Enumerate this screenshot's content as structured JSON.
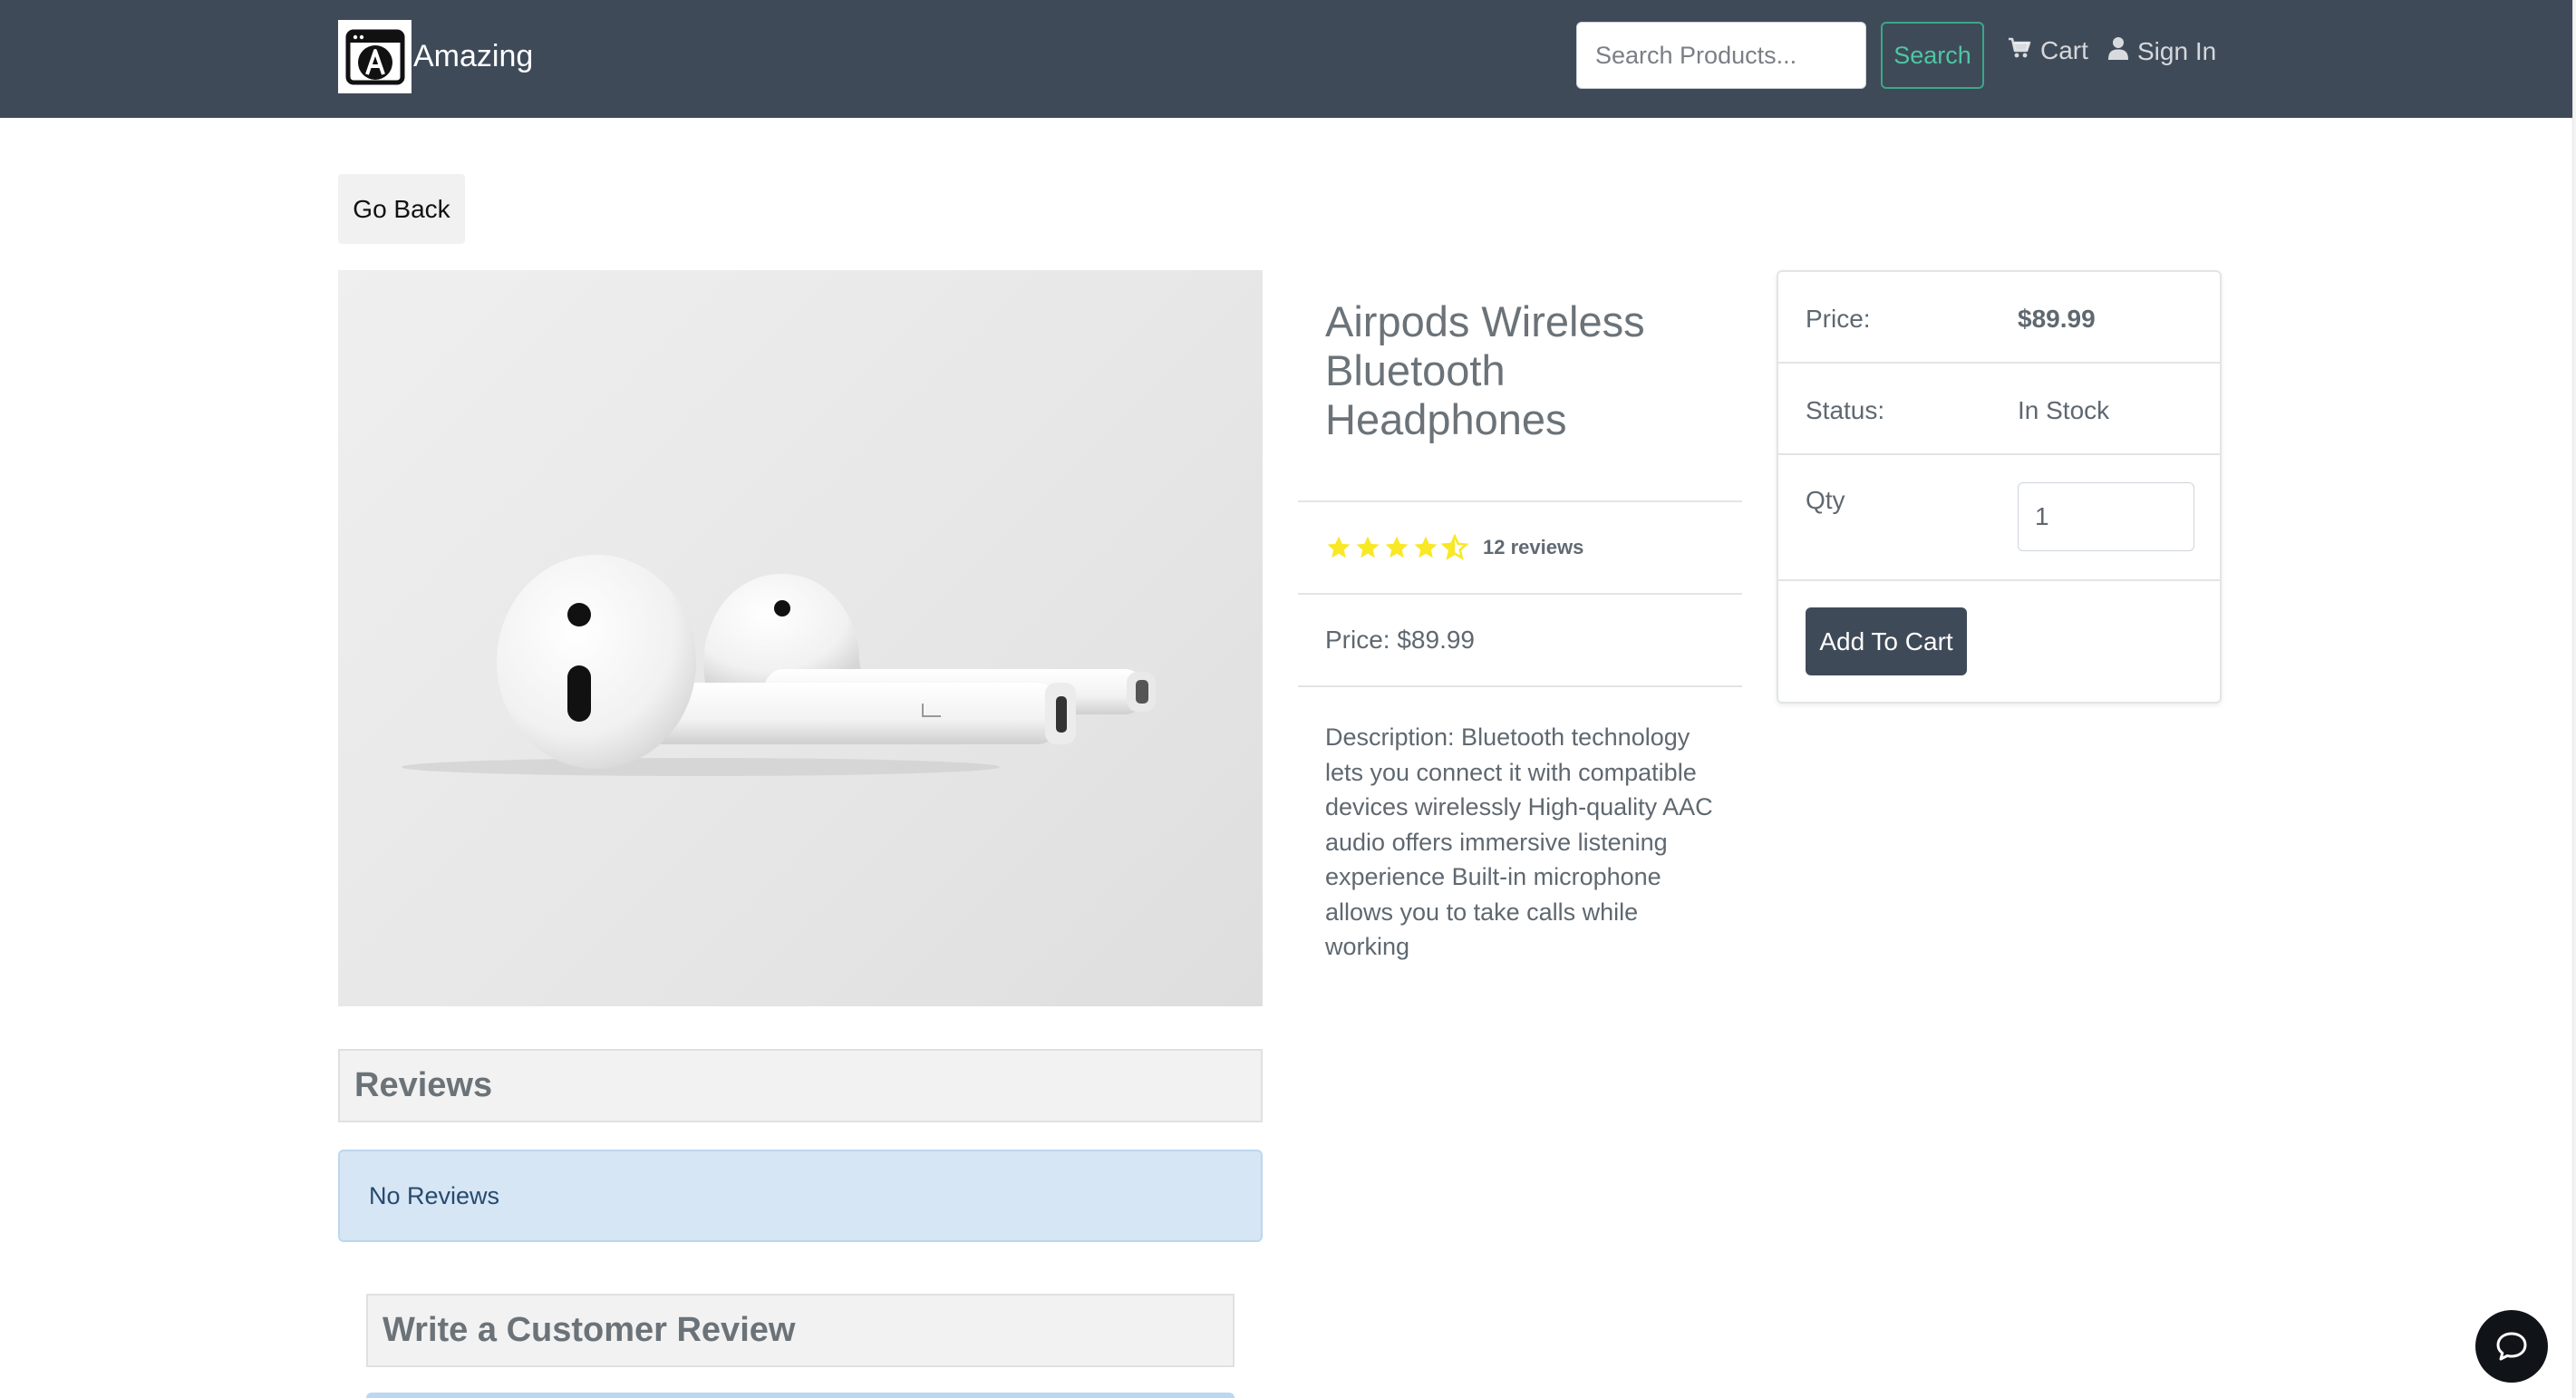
{
  "navbar": {
    "brand": "Amazing",
    "search_placeholder": "Search Products...",
    "search_button": "Search",
    "cart": "Cart",
    "sign_in": "Sign In",
    "background_color": "#3f4a59",
    "accent_color": "#4fc6a1"
  },
  "page": {
    "go_back": "Go Back"
  },
  "product": {
    "title": "Airpods Wireless Bluetooth Headphones",
    "rating": 4.5,
    "reviews_label": "12 reviews",
    "price_line": "Price: $89.99",
    "description": "Description: Bluetooth technology lets you connect it with compatible devices wirelessly High-quality AAC audio offers immersive listening experience Built-in microphone allows you to take calls while working",
    "star_color": "#f8e825"
  },
  "card": {
    "price_label": "Price:",
    "price_value": "$89.99",
    "status_label": "Status:",
    "status_value": "In Stock",
    "qty_label": "Qty",
    "qty_value": "1",
    "add_button": "Add To Cart"
  },
  "reviews": {
    "heading": "Reviews",
    "empty_message": "No Reviews",
    "write_heading": "Write a Customer Review",
    "alert_color": "#d6e6f4"
  },
  "icons": {
    "logo": "amazing-logo-icon",
    "cart": "cart-icon",
    "user": "user-icon",
    "star": "star-icon",
    "chat": "chat-icon"
  }
}
